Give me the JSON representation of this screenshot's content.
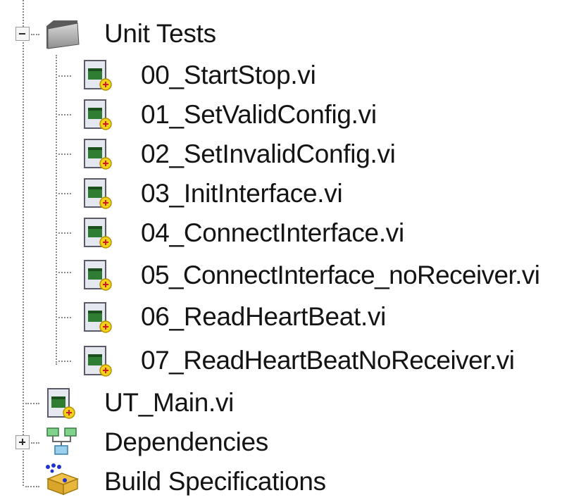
{
  "tree": {
    "folder": {
      "label": "Unit Tests",
      "icon": "folder-icon",
      "expander": "collapse",
      "children": [
        {
          "label": "00_StartStop.vi",
          "icon": "vi-file-icon"
        },
        {
          "label": "01_SetValidConfig.vi",
          "icon": "vi-file-icon"
        },
        {
          "label": "02_SetInvalidConfig.vi",
          "icon": "vi-file-icon"
        },
        {
          "label": "03_InitInterface.vi",
          "icon": "vi-file-icon"
        },
        {
          "label": "04_ConnectInterface.vi",
          "icon": "vi-file-icon"
        },
        {
          "label": "05_ConnectInterface_noReceiver.vi",
          "icon": "vi-file-icon"
        },
        {
          "label": "06_ReadHeartBeat.vi",
          "icon": "vi-file-icon"
        },
        {
          "label": "07_ReadHeartBeatNoReceiver.vi",
          "icon": "vi-file-icon"
        }
      ]
    },
    "ut_main": {
      "label": "UT_Main.vi",
      "icon": "vi-file-icon"
    },
    "dependencies": {
      "label": "Dependencies",
      "icon": "dependencies-icon",
      "expander": "expand"
    },
    "build_specs": {
      "label": "Build Specifications",
      "icon": "build-specifications-icon"
    }
  }
}
